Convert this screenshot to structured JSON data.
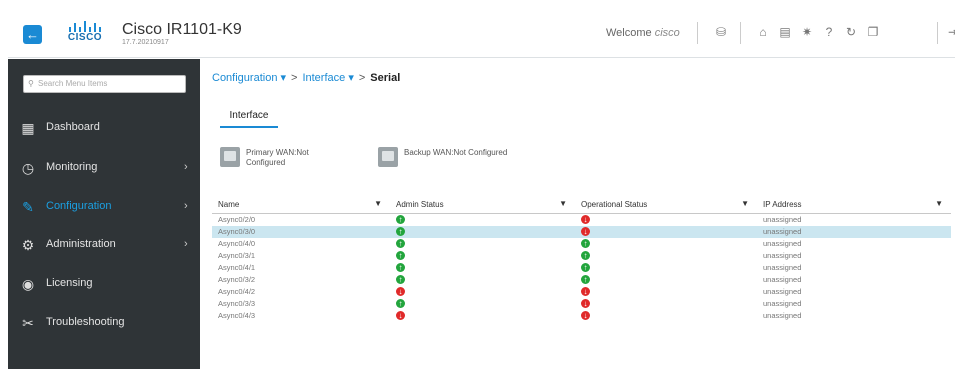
{
  "header": {
    "product": "Cisco IR1101-K9",
    "version": "17.7.20210917",
    "logo_text": "CISCO",
    "welcome": "Welcome",
    "user": "cisco"
  },
  "sidebar": {
    "search_placeholder": "Search Menu Items",
    "items": [
      {
        "label": "Dashboard",
        "icon": "dashboard-icon",
        "chevron": ""
      },
      {
        "label": "Monitoring",
        "icon": "monitoring-icon",
        "chevron": "›"
      },
      {
        "label": "Configuration",
        "icon": "configuration-icon",
        "chevron": "›"
      },
      {
        "label": "Administration",
        "icon": "administration-icon",
        "chevron": "›"
      },
      {
        "label": "Licensing",
        "icon": "licensing-icon",
        "chevron": ""
      },
      {
        "label": "Troubleshooting",
        "icon": "troubleshooting-icon",
        "chevron": ""
      }
    ]
  },
  "breadcrumb": {
    "level1": "Configuration",
    "level2": "Interface",
    "current": "Serial"
  },
  "tab": {
    "label": "Interface"
  },
  "wan": {
    "primary_line1": "Primary WAN:Not",
    "primary_line2": "Configured",
    "backup": "Backup WAN:Not Configured"
  },
  "table": {
    "columns": [
      "Name",
      "Admin Status",
      "Operational Status",
      "IP Address"
    ],
    "rows": [
      {
        "name": "Async0/2/0",
        "admin": "up",
        "oper": "down",
        "ip": "unassigned"
      },
      {
        "name": "Async0/3/0",
        "admin": "up",
        "oper": "down",
        "ip": "unassigned"
      },
      {
        "name": "Async0/4/0",
        "admin": "up",
        "oper": "up",
        "ip": "unassigned"
      },
      {
        "name": "Async0/3/1",
        "admin": "up",
        "oper": "up",
        "ip": "unassigned"
      },
      {
        "name": "Async0/4/1",
        "admin": "up",
        "oper": "up",
        "ip": "unassigned"
      },
      {
        "name": "Async0/3/2",
        "admin": "up",
        "oper": "up",
        "ip": "unassigned"
      },
      {
        "name": "Async0/4/2",
        "admin": "down",
        "oper": "down",
        "ip": "unassigned"
      },
      {
        "name": "Async0/3/3",
        "admin": "up",
        "oper": "down",
        "ip": "unassigned"
      },
      {
        "name": "Async0/4/3",
        "admin": "down",
        "oper": "down",
        "ip": "unassigned"
      }
    ],
    "selected_index": 1
  },
  "colors": {
    "accent": "#1a8ad4",
    "sidebar_bg": "#2f3437",
    "status_up": "#23a53d",
    "status_down": "#e02a2a",
    "row_selected": "#cbe6f0"
  }
}
